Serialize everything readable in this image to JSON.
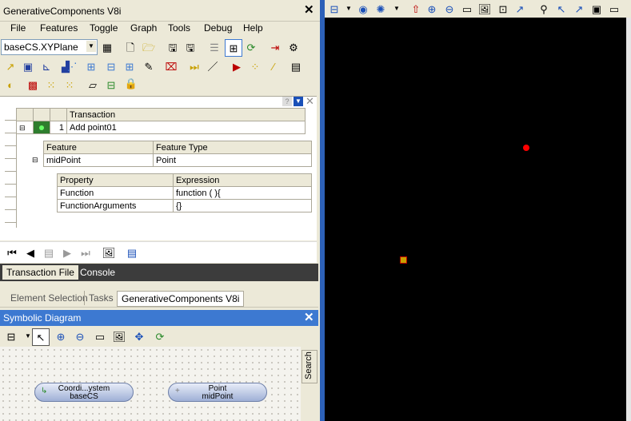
{
  "app": {
    "title": "GenerativeComponents V8i"
  },
  "menu": [
    "File",
    "Features",
    "Toggle",
    "Graph",
    "Tools",
    "Debug",
    "Help"
  ],
  "coordinate_combo": {
    "value": "baseCS.XYPlane"
  },
  "transactions": {
    "header": "Transaction",
    "rows": [
      {
        "index": "1",
        "name": "Add point01"
      }
    ]
  },
  "features": {
    "headers": [
      "Feature",
      "Feature Type"
    ],
    "rows": [
      {
        "feature": "midPoint",
        "type": "Point"
      }
    ]
  },
  "properties": {
    "headers": [
      "Property",
      "Expression"
    ],
    "rows": [
      {
        "property": "Function",
        "expression": "function ( ){"
      },
      {
        "property": "FunctionArguments",
        "expression": "{}"
      }
    ]
  },
  "bottom_tabs": [
    "Transaction File",
    "Console"
  ],
  "panel_tabs": [
    "Element Selection",
    "Tasks",
    "GenerativeComponents V8i"
  ],
  "symbolic": {
    "title": "Symbolic Diagram",
    "nodes": [
      {
        "line1": "Coordi...ystem",
        "line2": "baseCS"
      },
      {
        "line1": "Point",
        "line2": "midPoint"
      }
    ],
    "search_label": "Search"
  },
  "colors": {
    "accent": "#3d79d1",
    "view_bg": "#000000",
    "point_red": "#ff0000",
    "node_fill": "#9fb0d6"
  },
  "icons": [
    "folder-icon",
    "save-icon",
    "zoom-in-icon",
    "zoom-out-icon",
    "pointer-icon",
    "refresh-icon",
    "close-icon",
    "point-icon"
  ]
}
